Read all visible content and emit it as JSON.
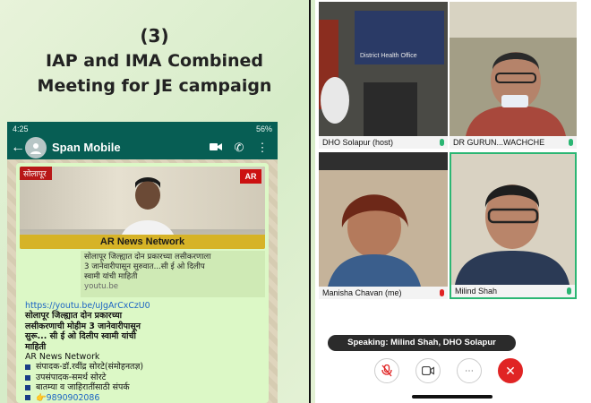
{
  "heading": {
    "number": "(3)",
    "line1": "IAP and IMA Combined",
    "line2": "Meeting for JE campaign"
  },
  "phone": {
    "status_time": "4:25",
    "status_right": "56%",
    "contact_name": "Span Mobile",
    "video": {
      "location_tag": "सोलापूर",
      "logo_text": "AR",
      "banner": "AR News Network"
    },
    "link_preview": {
      "line1": "सोलापूर जिल्ह्यात दोन प्रकारच्या लसीकरणाला",
      "line2": "3 जानेवारीपासून सुरुवात...सी ई ओ दिलीप",
      "line3": "स्वामी यांची माहिती",
      "domain": "youtu.be"
    },
    "message": {
      "url": "https://youtu.be/uJgArCxCzU0",
      "bold1": "सोलापूर जिल्ह्यात दोन प्रकारच्या",
      "bold2": "लसीकरणाची मोहीम  3 जानेवारीपासून",
      "bold3": "सुरू... सी ई ओ दिलीप स्वामी यांची",
      "bold4": "माहिती",
      "network": "AR News Network",
      "items": [
        "संपादक-डॉ.रवींद्र सोरटे(संमोहनतज्ञ)",
        "उपसंपादक-समर्थ सोरटे",
        "बातम्या व जाहिरातींसाठी संपर्क",
        "👉9890902086"
      ]
    }
  },
  "meeting": {
    "tiles": [
      {
        "name": "DHO Solapur (host)",
        "mic": "on"
      },
      {
        "name": "DR GURUN...WACHCHE",
        "mic": "on"
      },
      {
        "name": "Manisha Chavan (me)",
        "mic": "muted"
      },
      {
        "name": "Milind Shah",
        "mic": "on"
      }
    ],
    "speaking": "Speaking: Milind Shah, DHO Solapur",
    "sign_text": "District Health Office",
    "colors": {
      "active_border": "#2bb673",
      "end_call": "#e02424",
      "mic_on": "#2bb673",
      "mic_muted": "#e02424"
    }
  }
}
